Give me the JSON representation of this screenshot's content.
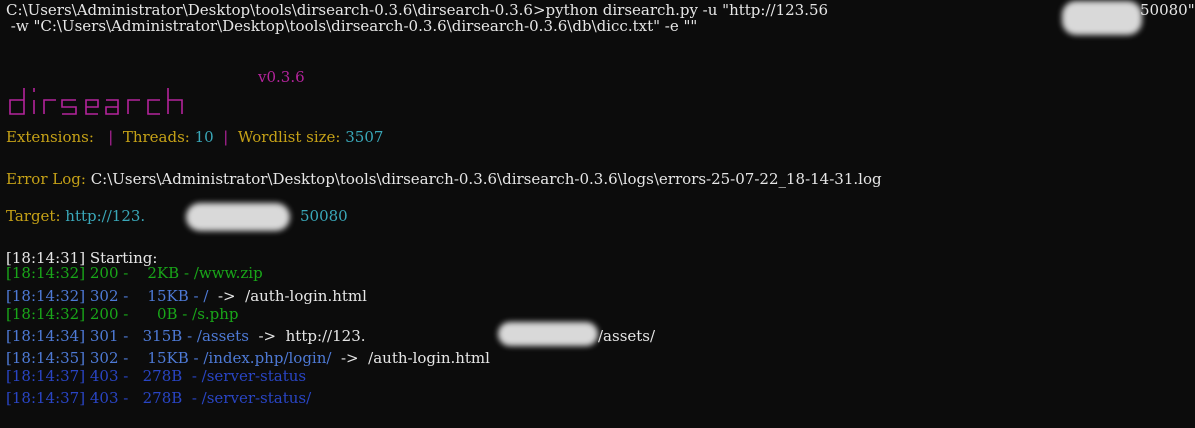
{
  "command": {
    "line1": "C:\\Users\\Administrator\\Desktop\\tools\\dirsearch-0.3.6\\dirsearch-0.3.6>python dirsearch.py -u \"http://123.56",
    "line1_end": "50080\"",
    "line2": " -w \"C:\\Users\\Administrator\\Desktop\\tools\\dirsearch-0.3.6\\dirsearch-0.3.6\\db\\dicc.txt\" -e \"\""
  },
  "banner": {
    "version": "v0.3.6",
    "logo_text": "dirsearch"
  },
  "config": {
    "extensions_label": "Extensions:",
    "extensions_value": "",
    "threads_label": "Threads:",
    "threads_value": "10",
    "wordlist_label": "Wordlist size:",
    "wordlist_value": "3507"
  },
  "error_log": {
    "label": "Error Log:",
    "path": "C:\\Users\\Administrator\\Desktop\\tools\\dirsearch-0.3.6\\dirsearch-0.3.6\\logs\\errors-25-07-22_18-14-31.log"
  },
  "target": {
    "label": "Target:",
    "url_start": "http://123.",
    "url_end": "50080"
  },
  "starting": "[18:14:31] Starting:",
  "results": [
    {
      "time": "[18:14:32]",
      "code": "200",
      "size": "2KB",
      "path": "/www.zip",
      "redirect": ""
    },
    {
      "time": "[18:14:32]",
      "code": "302",
      "size": "15KB",
      "path": "/",
      "redirect": "/auth-login.html"
    },
    {
      "time": "[18:14:32]",
      "code": "200",
      "size": "0B",
      "path": "/s.php",
      "redirect": ""
    },
    {
      "time": "[18:14:34]",
      "code": "301",
      "size": "315B",
      "path": "/assets",
      "redirect": "http://123.",
      "redirect_end": "/assets/"
    },
    {
      "time": "[18:14:35]",
      "code": "302",
      "size": "15KB",
      "path": "/index.php/login/",
      "redirect": "/auth-login.html"
    },
    {
      "time": "[18:14:37]",
      "code": "403",
      "size": "278B",
      "path": "/server-status",
      "redirect": ""
    },
    {
      "time": "[18:14:37]",
      "code": "403",
      "size": "278B",
      "path": "/server-status/",
      "redirect": ""
    }
  ],
  "colors": {
    "background": "#0c0c0c",
    "default_text": "#cccccc",
    "label_gold": "#c5a117",
    "value_teal": "#3aa8b9",
    "banner_magenta": "#b4249c",
    "status_200": "#19a619",
    "status_30x": "#4e7ad6",
    "status_403": "#2945c4"
  }
}
